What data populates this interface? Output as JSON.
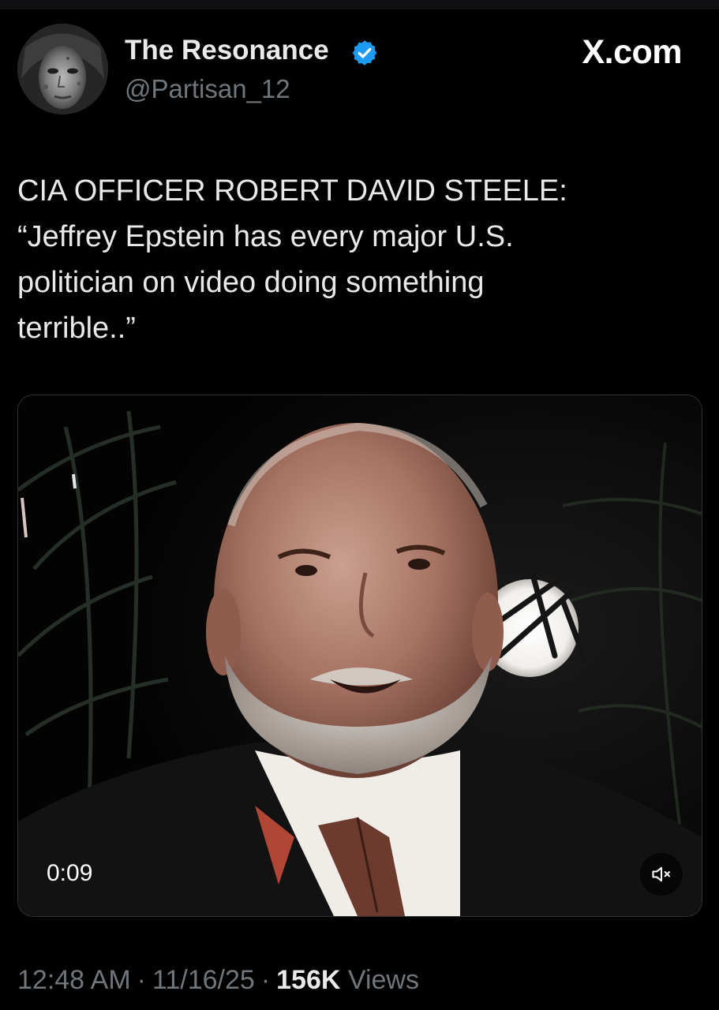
{
  "tweet": {
    "author": {
      "display_name": "The Resonance",
      "handle": "@Partisan_12",
      "verified": true,
      "verified_color": "#1d9bf0"
    },
    "brand": "X.com",
    "text_lines": [
      "CIA OFFICER ROBERT DAVID STEELE:",
      "“Jeffrey Epstein has every major U.S.",
      "politician on video doing something",
      "terrible..”"
    ],
    "media": {
      "type": "video",
      "timecode": "0:09",
      "muted": true,
      "mute_icon": "speaker-muted-icon"
    },
    "meta": {
      "time": "12:48 AM",
      "separator": "·",
      "date": "11/16/25",
      "views_count": "156K",
      "views_label": "Views"
    }
  },
  "colors": {
    "background": "#000000",
    "primary_text": "#e7e9ea",
    "secondary_text": "#71767b",
    "accent": "#1d9bf0"
  }
}
